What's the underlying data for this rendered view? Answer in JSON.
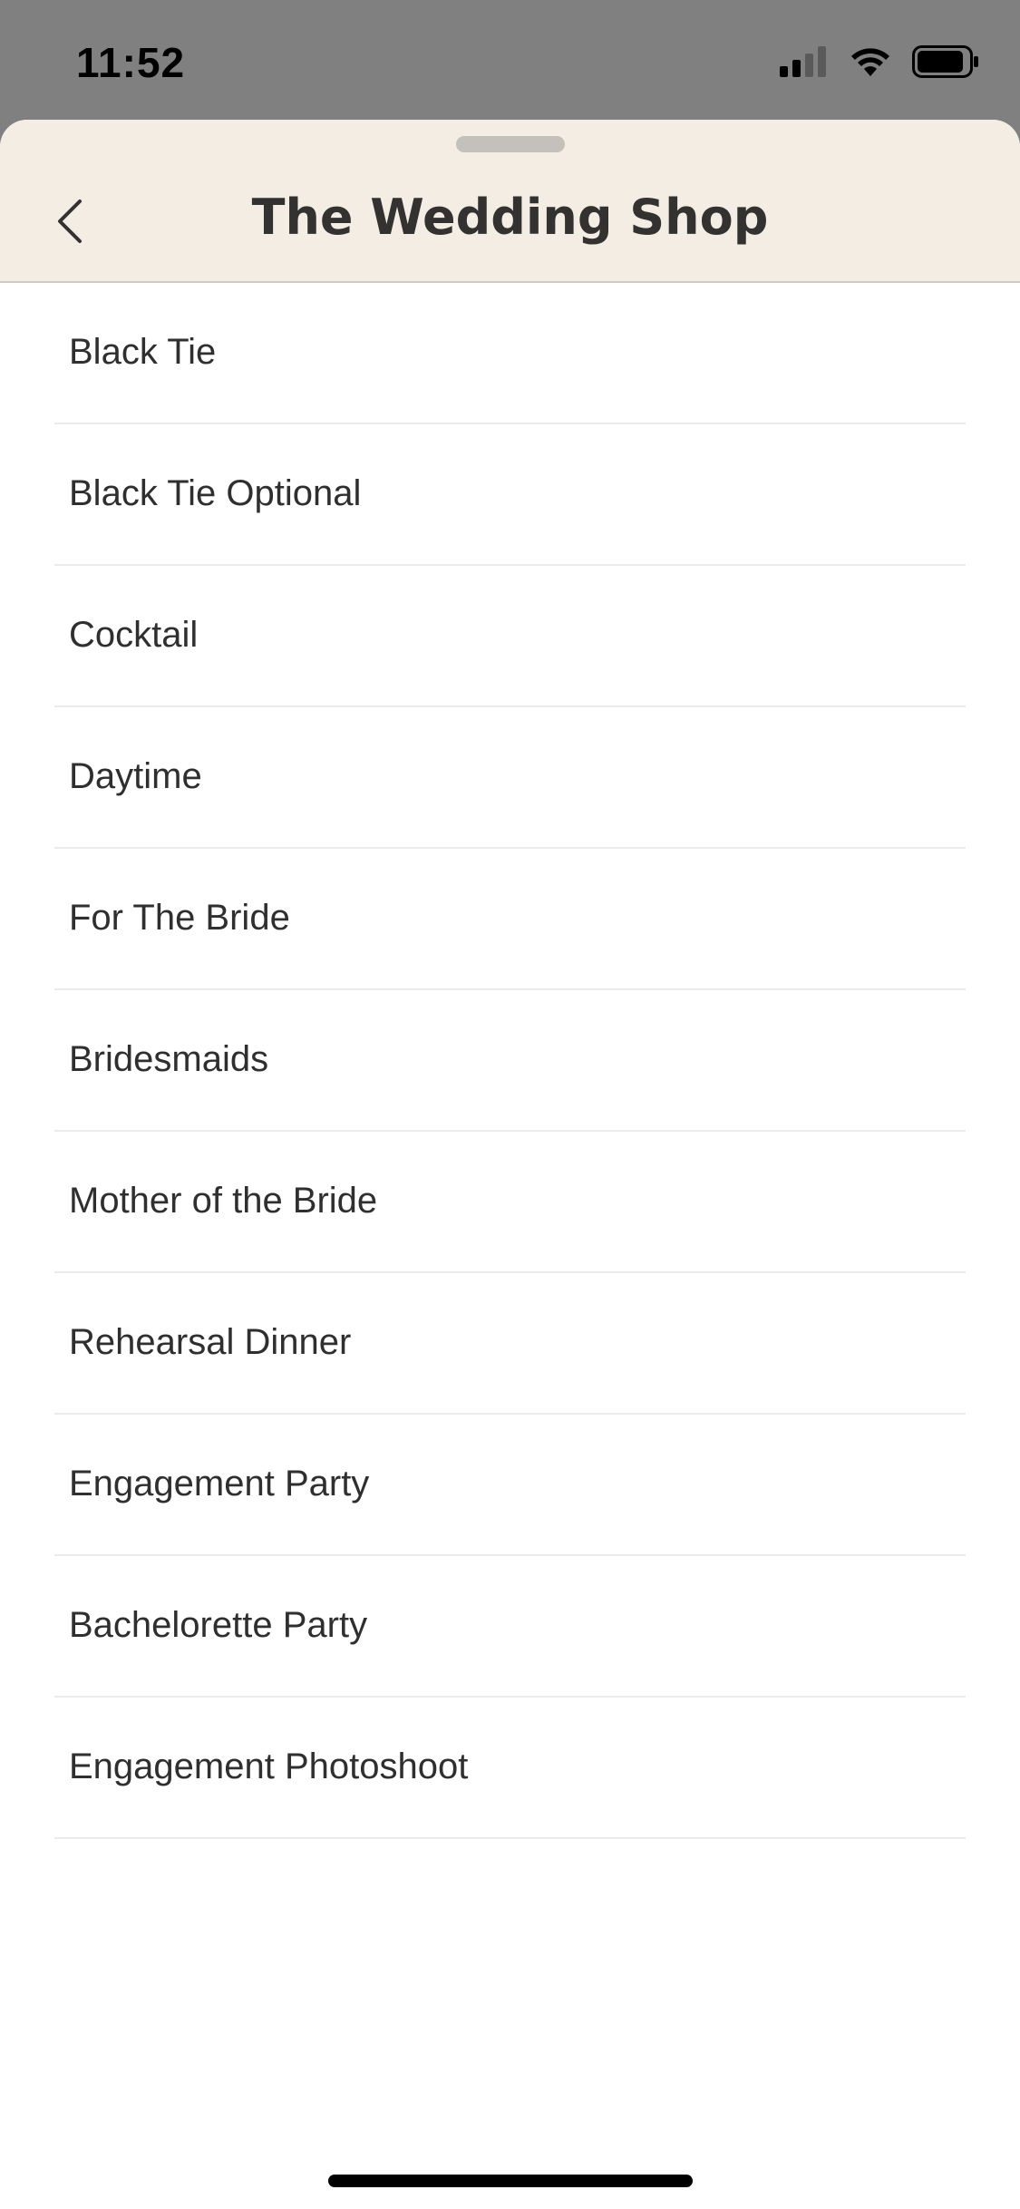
{
  "status_bar": {
    "time": "11:52"
  },
  "header": {
    "title": "The Wedding Shop",
    "back_icon": "chevron-left-icon"
  },
  "list": {
    "items": [
      "Black Tie",
      "Black Tie Optional",
      "Cocktail",
      "Daytime",
      "For The Bride",
      "Bridesmaids",
      "Mother of the Bride",
      "Rehearsal Dinner",
      "Engagement Party",
      "Bachelorette Party",
      "Engagement Photoshoot"
    ]
  },
  "colors": {
    "header_background": "#f4ede4",
    "status_background": "#808080",
    "text": "#2f2f2f"
  }
}
